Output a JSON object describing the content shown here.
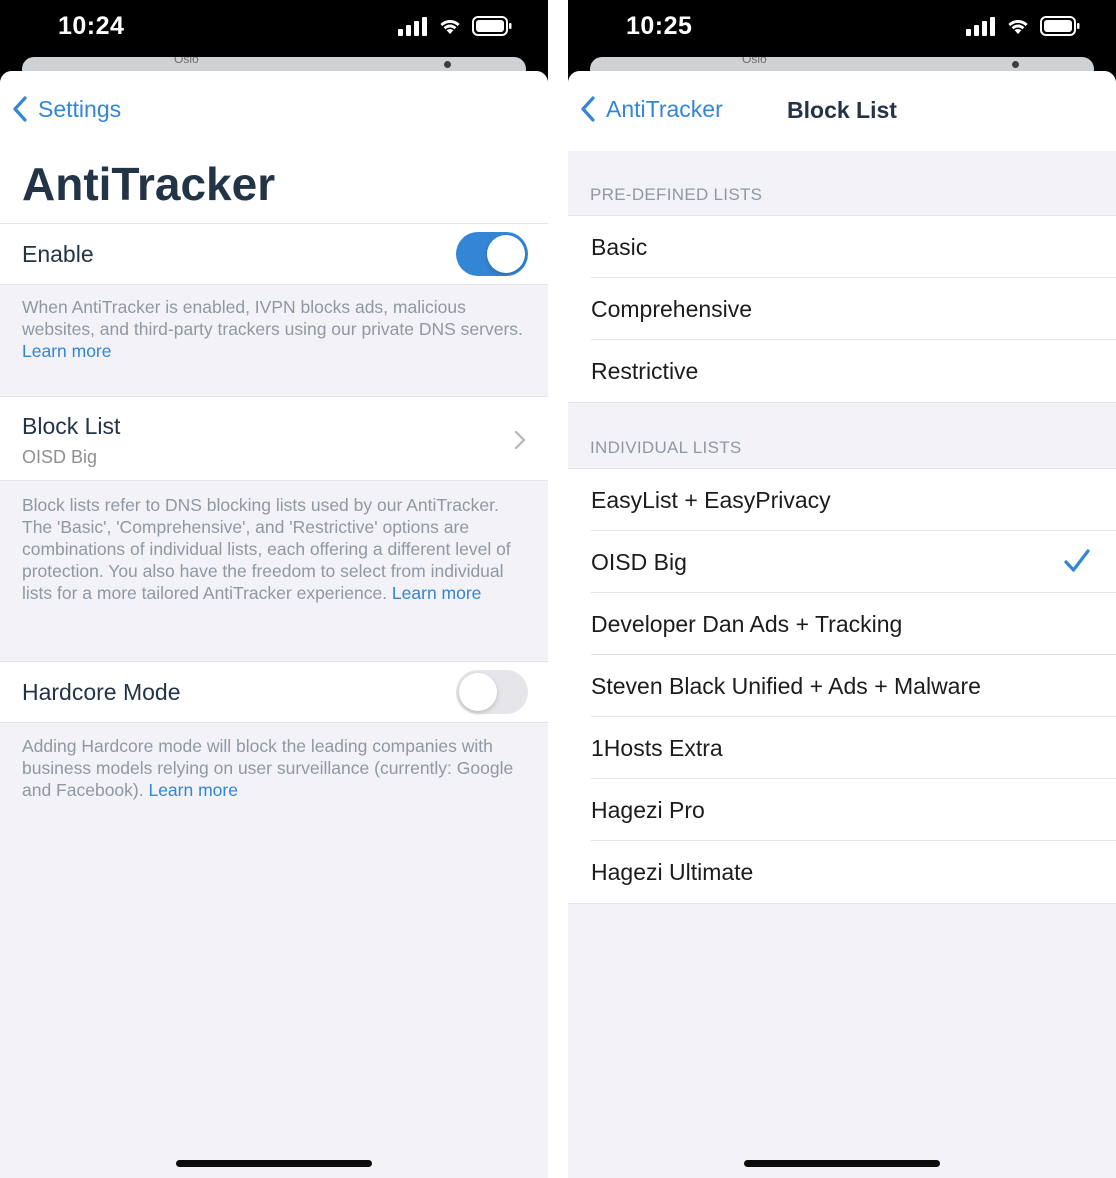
{
  "colors": {
    "accent": "#3385d6",
    "title": "#243447",
    "secondary_text": "#8f98a3",
    "background_grouped": "#f2f2f7",
    "toggle_off": "#e6e6ea"
  },
  "left_screen": {
    "status": {
      "time": "10:24",
      "icons": [
        "cellular-signal-icon",
        "wifi-icon",
        "battery-icon"
      ]
    },
    "behind": {
      "city": "Oslo"
    },
    "nav": {
      "back_label": "Settings",
      "back_icon": "chevron-left-icon"
    },
    "title": "AntiTracker",
    "enable": {
      "label": "Enable",
      "on": true
    },
    "enable_footer": {
      "text": "When AntiTracker is enabled, IVPN blocks ads, malicious websites, and third-party trackers using our private DNS servers. ",
      "link": "Learn more"
    },
    "block_list": {
      "label": "Block List",
      "value": "OISD Big",
      "icon": "chevron-right-icon"
    },
    "block_list_footer": {
      "text": "Block lists refer to DNS blocking lists used by our AntiTracker. The 'Basic', 'Comprehensive', and 'Restrictive' options are combinations of individual lists, each offering a different level of protection. You also have the freedom to select from individual lists for a more tailored AntiTracker experience. ",
      "link": "Learn more"
    },
    "hardcore": {
      "label": "Hardcore Mode",
      "on": false
    },
    "hardcore_footer": {
      "text": "Adding Hardcore mode will block the leading companies with business models relying on user surveillance (currently: Google and Facebook). ",
      "link": "Learn more"
    }
  },
  "right_screen": {
    "status": {
      "time": "10:25",
      "icons": [
        "cellular-signal-icon",
        "wifi-icon",
        "battery-icon"
      ]
    },
    "behind": {
      "city": "Oslo"
    },
    "nav": {
      "back_label": "AntiTracker",
      "title": "Block List",
      "back_icon": "chevron-left-icon"
    },
    "predefined": {
      "header": "PRE-DEFINED LISTS",
      "items": [
        "Basic",
        "Comprehensive",
        "Restrictive"
      ]
    },
    "individual": {
      "header": "INDIVIDUAL LISTS",
      "items": [
        "EasyList + EasyPrivacy",
        "OISD Big",
        "Developer Dan Ads + Tracking",
        "Steven Black Unified + Ads + Malware",
        "1Hosts Extra",
        "Hagezi Pro",
        "Hagezi Ultimate"
      ],
      "selected": "OISD Big",
      "check_icon": "checkmark-icon"
    }
  }
}
